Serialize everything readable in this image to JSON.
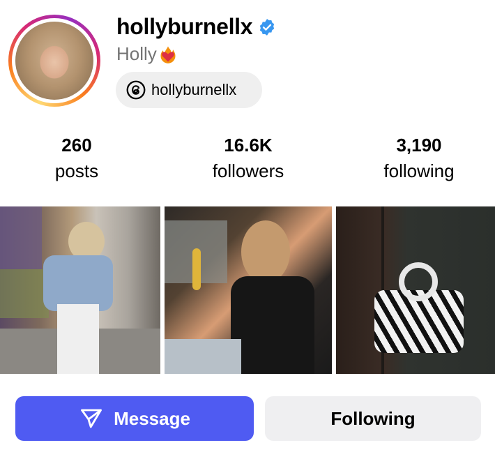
{
  "profile": {
    "username": "hollyburnellx",
    "display_name": "Holly",
    "display_name_emoji": "heart-on-fire-emoji",
    "verified": true,
    "threads_handle": "hollyburnellx",
    "avatar": "profile-photo"
  },
  "stats": [
    {
      "value": "260",
      "label": "posts"
    },
    {
      "value": "16.6K",
      "label": "followers"
    },
    {
      "value": "3,190",
      "label": "following"
    }
  ],
  "posts": [
    {
      "subject": "photo-street-flower-stall"
    },
    {
      "subject": "photo-taxi-interior"
    },
    {
      "subject": "photo-zebra-print-bag"
    }
  ],
  "actions": {
    "message_label": "Message",
    "following_label": "Following"
  },
  "colors": {
    "message_button": "#4f5bf2",
    "following_button": "#efeff1",
    "verified_badge": "#3897f0",
    "muted_text": "#737373"
  }
}
